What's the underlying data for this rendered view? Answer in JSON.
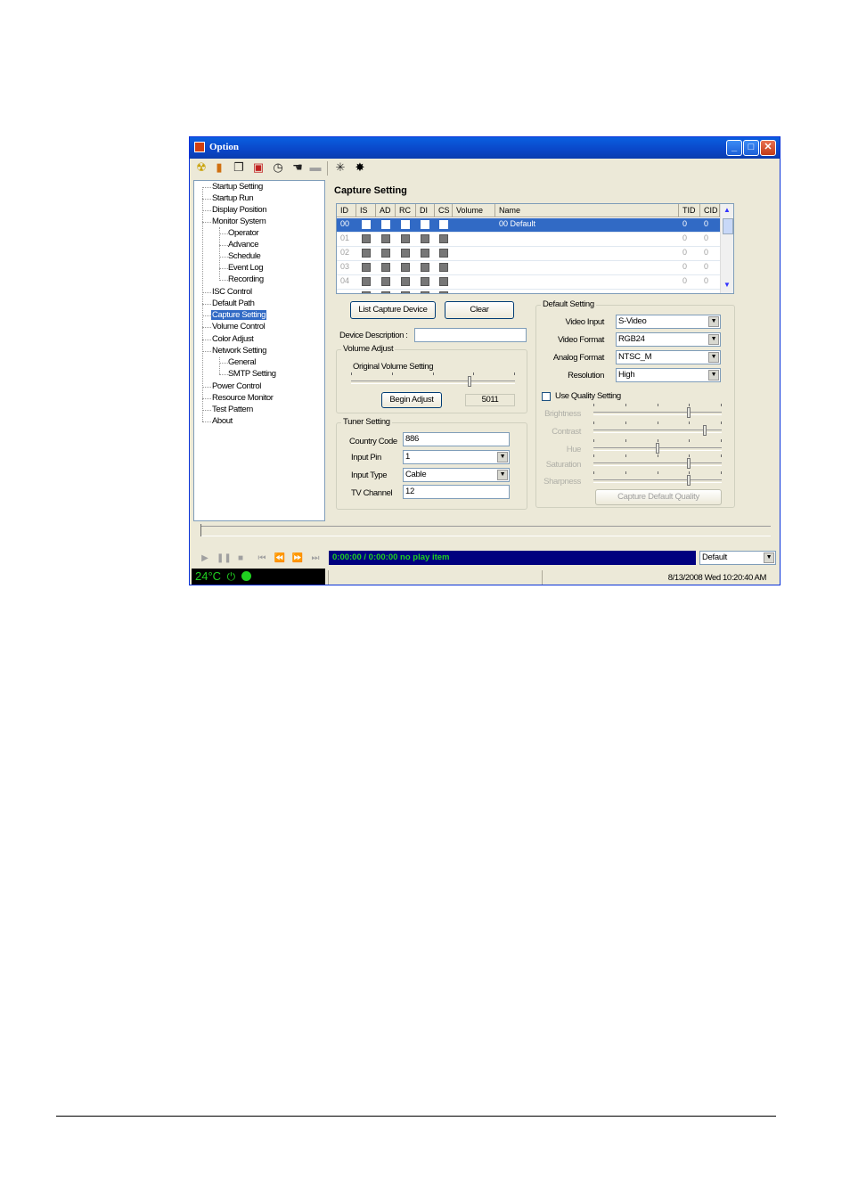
{
  "window": {
    "title": "Option",
    "controls": {
      "minimize": "_",
      "maximize": "□",
      "close": "✕"
    }
  },
  "toolbar": {
    "icons": [
      "radiation-icon",
      "folder-icon",
      "pages-icon",
      "save-icon",
      "clock-icon",
      "hand-icon",
      "box-icon",
      "burst-icon",
      "burst-dark-icon"
    ]
  },
  "tree": {
    "items": [
      "Startup Setting",
      "Startup Run",
      "Display Position",
      "Monitor System",
      "Operator",
      "Advance",
      "Schedule",
      "Event Log",
      "Recording",
      "ISC Control",
      "Default Path",
      "Capture Setting",
      "Volume Control",
      "Color Adjust",
      "Network Setting",
      "General",
      "SMTP Setting",
      "Power Control",
      "Resource Monitor",
      "Test Pattern",
      "About"
    ]
  },
  "capture": {
    "title": "Capture Setting",
    "columns": [
      "ID",
      "IS",
      "AD",
      "RC",
      "DI",
      "CS",
      "Volume",
      "Name",
      "TID",
      "CID"
    ],
    "rows": [
      {
        "id": "00",
        "name": "00 Default",
        "tid": "0",
        "cid": "0"
      },
      {
        "id": "01",
        "name": "",
        "tid": "0",
        "cid": "0"
      },
      {
        "id": "02",
        "name": "",
        "tid": "0",
        "cid": "0"
      },
      {
        "id": "03",
        "name": "",
        "tid": "0",
        "cid": "0"
      },
      {
        "id": "04",
        "name": "",
        "tid": "0",
        "cid": "0"
      }
    ],
    "list_button": "List Capture Device",
    "clear_button": "Clear",
    "device_description_label": "Device Description :",
    "device_description_value": ""
  },
  "volume": {
    "group_label": "Volume Adjust",
    "original_label": "Original Volume Setting",
    "slider_level": 0.73,
    "begin_button": "Begin Adjust",
    "value": "5011"
  },
  "tuner": {
    "group_label": "Tuner Setting",
    "country_code_label": "Country Code",
    "country_code": "886",
    "input_pin_label": "Input Pin",
    "input_pin": "1",
    "input_type_label": "Input Type",
    "input_type": "Cable",
    "tv_channel_label": "TV Channel",
    "tv_channel": "12"
  },
  "default_setting": {
    "group_label": "Default Setting",
    "video_input_label": "Video Input",
    "video_input": "S-Video",
    "video_format_label": "Video Format",
    "video_format": "RGB24",
    "analog_format_label": "Analog Format",
    "analog_format": "NTSC_M",
    "resolution_label": "Resolution",
    "resolution": "High",
    "use_quality_label": "Use Quality Setting",
    "quality": [
      {
        "label": "Brightness",
        "level": 0.75
      },
      {
        "label": "Contrast",
        "level": 0.88
      },
      {
        "label": "Hue",
        "level": 0.5
      },
      {
        "label": "Saturation",
        "level": 0.75
      },
      {
        "label": "Sharpness",
        "level": 0.75
      }
    ],
    "capture_quality_button": "Capture Default Quality"
  },
  "player": {
    "display": "0:00:00 / 0:00:00  no play item",
    "profile": "Default",
    "buttons": [
      "play-icon",
      "pause-icon",
      "stop-icon",
      "first-icon",
      "prev-icon",
      "next-icon",
      "last-icon"
    ]
  },
  "status": {
    "temperature": "24°C",
    "datetime": "8/13/2008 Wed 10:20:40 AM"
  },
  "colors": {
    "title_bar": "#0a46c8",
    "selection": "#316ac5",
    "display_bg": "#00007f",
    "display_text": "#20d020"
  }
}
